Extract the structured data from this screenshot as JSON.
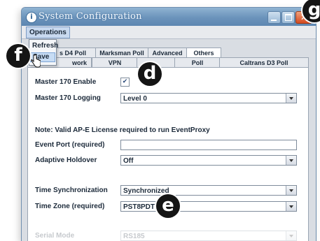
{
  "window": {
    "title": "System Configuration",
    "app_icon": "info-icon",
    "controls": {
      "minimize": "minimize-icon",
      "maximize": "maximize-icon",
      "close": "close-icon"
    }
  },
  "menu": {
    "operations_label": "Operations",
    "items": [
      "Refresh",
      "Save"
    ]
  },
  "tabs": {
    "row1": [
      "s D4 Poll",
      "Marksman Poll",
      "Advanced",
      "Others"
    ],
    "row1_active": "Others",
    "row2": [
      "Network",
      "VPN",
      "",
      "Poll",
      "Caltrans D3 Poll"
    ],
    "row2_first_visible": "work"
  },
  "form": {
    "master_170_enable": {
      "label": "Master 170 Enable",
      "checked": true,
      "check_glyph": "✔"
    },
    "master_170_logging": {
      "label": "Master 170 Logging",
      "value": "Level 0"
    },
    "note": "Note: Valid AP-E License required to run EventProxy",
    "event_port": {
      "label": "Event Port (required)",
      "value": ""
    },
    "adaptive_holdover": {
      "label": "Adaptive Holdover",
      "value": "Off"
    },
    "time_sync": {
      "label": "Time Synchronization",
      "value": "Synchronized"
    },
    "time_zone": {
      "label": "Time Zone (required)",
      "value": "PST8PDT"
    },
    "serial_mode": {
      "label": "Serial Mode",
      "value": "RS185"
    }
  },
  "callouts": {
    "d": "d",
    "e": "e",
    "f": "f",
    "g": "g"
  },
  "colors": {
    "titlebar": "#6b93bb",
    "close_button": "#d4491f",
    "highlight": "#c7dcf4"
  }
}
